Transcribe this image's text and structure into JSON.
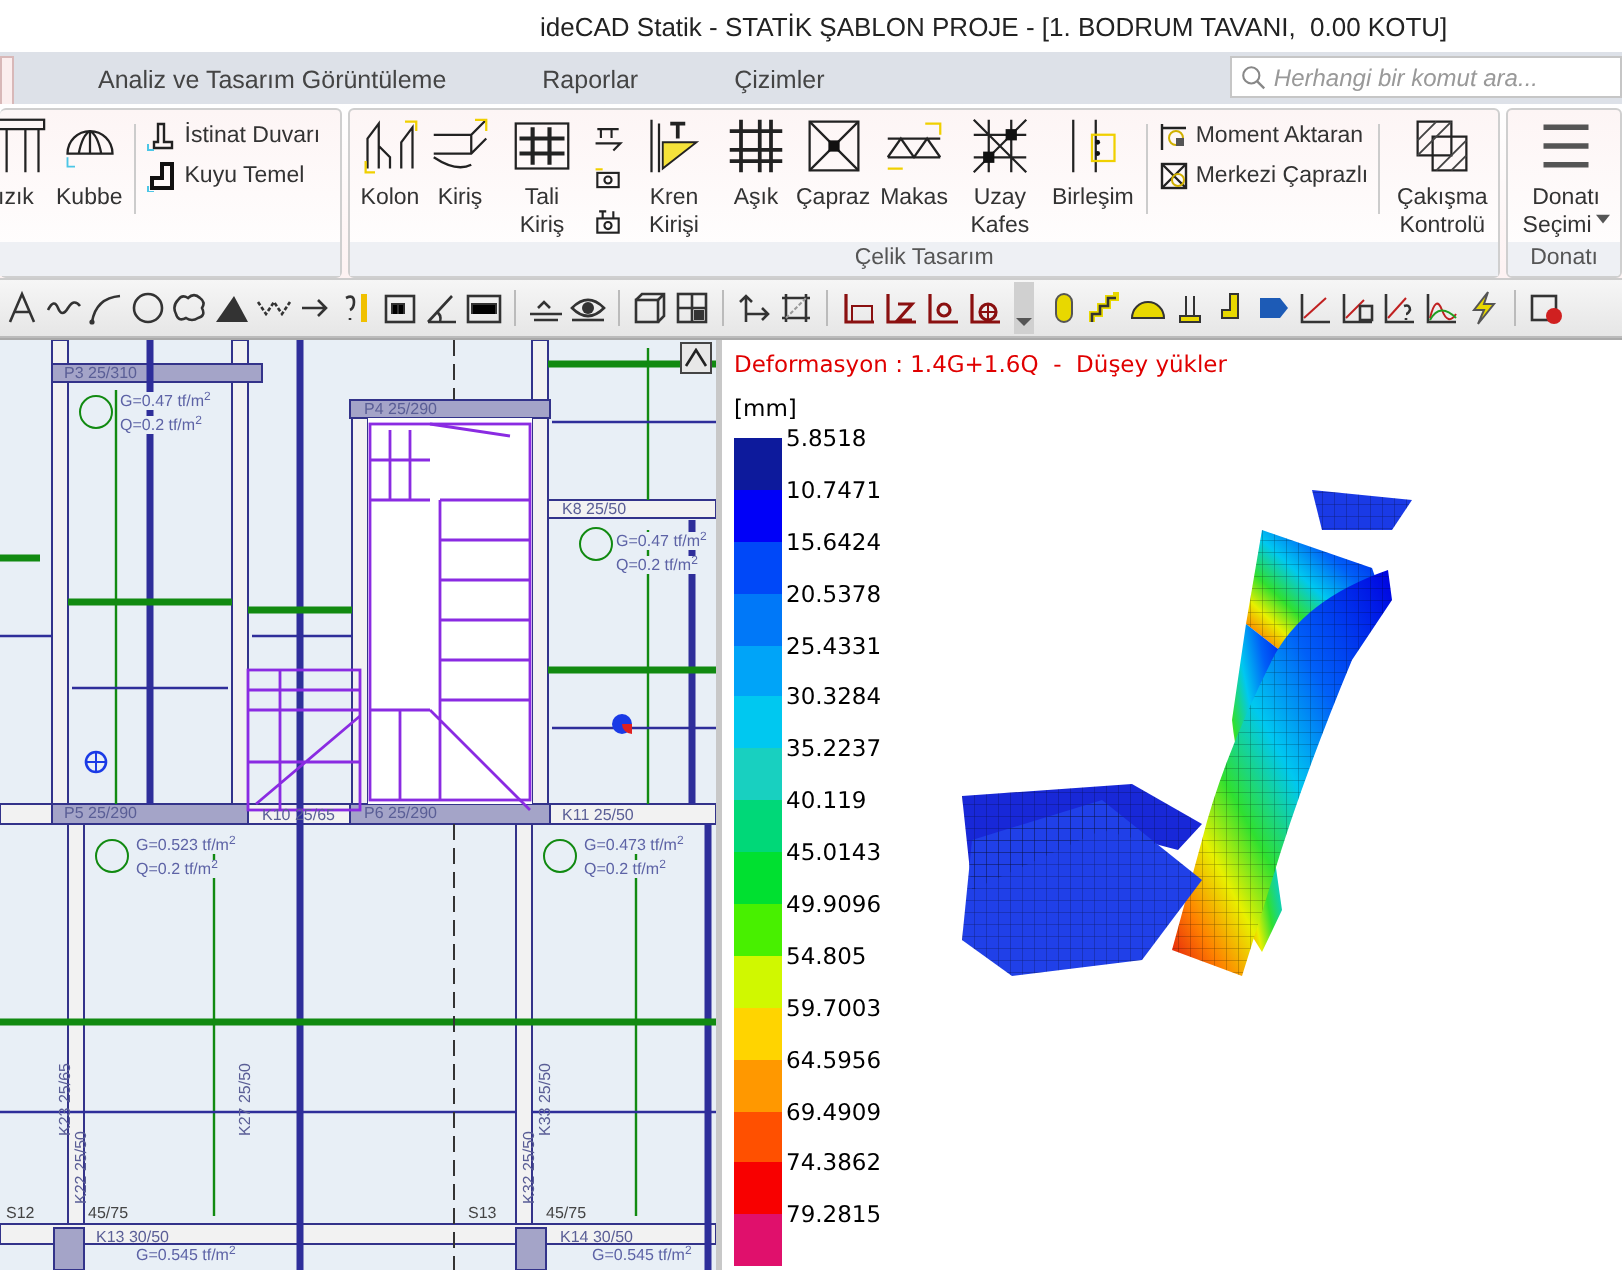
{
  "window": {
    "title": "ideCAD Statik - STATİK ŞABLON PROJE - [1. BODRUM TAVANI,  0.00 KOTU]"
  },
  "tabs": [
    {
      "selected": true
    },
    {
      "label": "Analiz ve Tasarım Görüntüleme",
      "selected": false
    },
    {
      "label": "Raporlar",
      "selected": false
    },
    {
      "label": "Çizimler",
      "selected": false
    }
  ],
  "search": {
    "placeholder": "Herhangi bir komut ara..."
  },
  "ribbon": {
    "groups": [
      {
        "columns": [
          {
            "kind": "large",
            "label": "ızık"
          },
          {
            "kind": "large",
            "label": "Kubbe"
          },
          {
            "kind": "separator"
          },
          {
            "kind": "stack",
            "items": [
              {
                "label": "İstinat Duvarı"
              },
              {
                "label": "Kuyu Temel"
              }
            ]
          }
        ]
      },
      {
        "label": "Çelik Tasarım",
        "columns": [
          {
            "kind": "large",
            "label": "Kolon"
          },
          {
            "kind": "large",
            "label": "Kiriş"
          },
          {
            "kind": "large",
            "label": "Tali Kiriş"
          },
          {
            "kind": "icon-stack"
          },
          {
            "kind": "large",
            "label": "Kren Kirişi"
          },
          {
            "kind": "large",
            "label": "Aşık"
          },
          {
            "kind": "large",
            "label": "Çapraz"
          },
          {
            "kind": "large",
            "label": "Makas"
          },
          {
            "kind": "large",
            "label": "Uzay Kafes"
          },
          {
            "kind": "large",
            "label": "Birleşim"
          },
          {
            "kind": "separator"
          },
          {
            "kind": "stack",
            "items": [
              {
                "label": "Moment Aktaran"
              },
              {
                "label": "Merkezi Çaprazlı"
              }
            ]
          },
          {
            "kind": "separator"
          },
          {
            "kind": "large",
            "label": "Çakışma Kontrolü"
          }
        ]
      },
      {
        "label": "Donatı",
        "columns": [
          {
            "kind": "large",
            "label": "Donatı Seçimi",
            "dropdown": true
          }
        ]
      }
    ]
  },
  "plan": {
    "labels": [
      {
        "kind": "beam",
        "text": "P3 25/310"
      },
      {
        "kind": "beam",
        "text": "P4 25/290"
      },
      {
        "kind": "beam",
        "text": "K8 25/50"
      },
      {
        "kind": "beam",
        "text": "P5 25/290"
      },
      {
        "kind": "beam",
        "text": "K10 25/65"
      },
      {
        "kind": "beam",
        "text": "P6 25/290"
      },
      {
        "kind": "beam",
        "text": "K11 25/50"
      },
      {
        "kind": "beam",
        "text": "K13 30/50"
      },
      {
        "kind": "beam",
        "text": "K14 30/50"
      },
      {
        "kind": "load",
        "text": "G=0.47 tf/m$^{2}$"
      },
      {
        "kind": "load",
        "text": "Q=0.2 tf/m$^{2}$"
      },
      {
        "kind": "load",
        "text": "G=0.47 tf/m$^{2}$"
      },
      {
        "kind": "load",
        "text": "Q=0.2 tf/m$^{2}$"
      },
      {
        "kind": "load",
        "text": "G=0.523 tf/m$^{2}$"
      },
      {
        "kind": "load",
        "text": "Q=0.2 tf/m$^{2}$"
      },
      {
        "kind": "load",
        "text": "G=0.473 tf/m$^{2}$"
      },
      {
        "kind": "load",
        "text": "Q=0.2 tf/m$^{2}$"
      },
      {
        "kind": "load",
        "text": "G=0.545 tf/m$^{2}$"
      },
      {
        "kind": "load",
        "text": "G=0.545 tf/m$^{2}$"
      },
      {
        "kind": "vertical",
        "text": "K23 25/65"
      },
      {
        "kind": "vertical",
        "text": "K27 25/50"
      },
      {
        "kind": "vertical",
        "text": "K33 25/50"
      },
      {
        "kind": "vertical",
        "text": "K22 25/50"
      },
      {
        "kind": "vertical",
        "text": "K32 25/50"
      },
      {
        "kind": "note",
        "text": "S12"
      },
      {
        "kind": "note",
        "text": "45/75"
      },
      {
        "kind": "note",
        "text": "S13"
      },
      {
        "kind": "note",
        "text": "45/75"
      }
    ]
  },
  "legend": {
    "title": "Deformasyon : 1.4G+1.6Q  -  Düşey yükler",
    "unit": "[mm]",
    "steps": [
      {
        "value": "5.8518",
        "color": "#0d1a9c"
      },
      {
        "value": "10.7471",
        "color": "#0000f8"
      },
      {
        "value": "15.6424",
        "color": "#0048f8"
      },
      {
        "value": "20.5378",
        "color": "#0078f8"
      },
      {
        "value": "25.4331",
        "color": "#00a4f8"
      },
      {
        "value": "30.3284",
        "color": "#00c8f0"
      },
      {
        "value": "35.2237",
        "color": "#18d0c0"
      },
      {
        "value": "40.119",
        "color": "#00d878"
      },
      {
        "value": "45.0143",
        "color": "#00e030"
      },
      {
        "value": "49.9096",
        "color": "#48f000"
      },
      {
        "value": "54.805",
        "color": "#d0f800"
      },
      {
        "value": "59.7003",
        "color": "#ffd400"
      },
      {
        "value": "64.5956",
        "color": "#ff9800"
      },
      {
        "value": "69.4909",
        "color": "#ff5000"
      },
      {
        "value": "74.3862",
        "color": "#f80000"
      },
      {
        "value": "79.2815",
        "color": "#e0106c"
      }
    ]
  }
}
